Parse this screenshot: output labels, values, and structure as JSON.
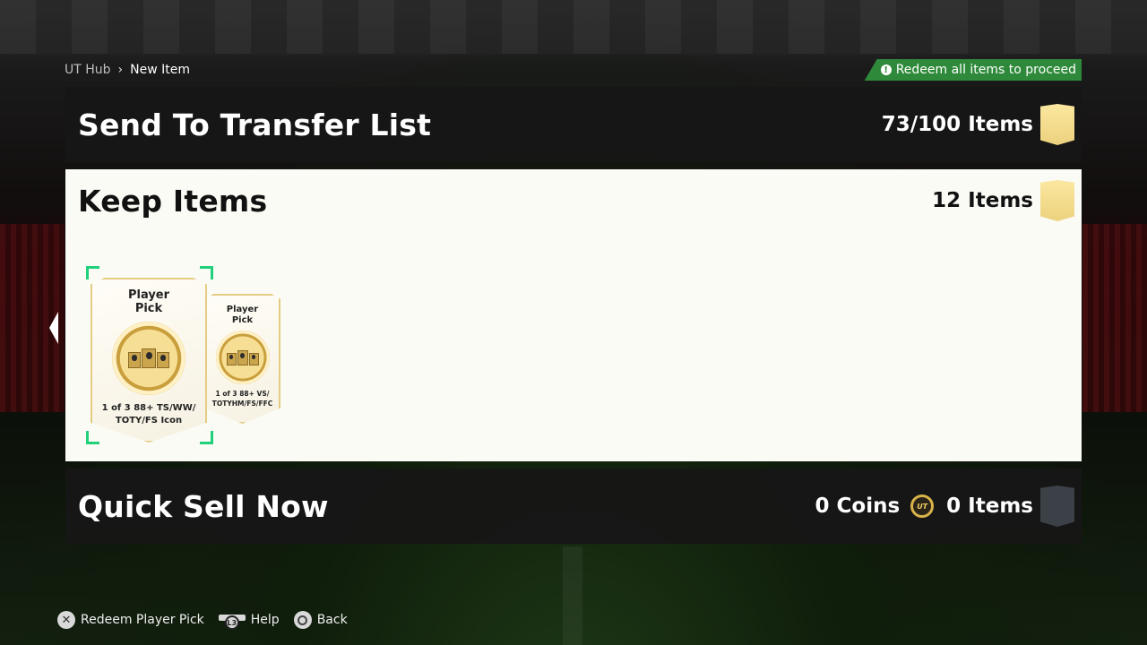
{
  "breadcrumb": {
    "root": "UT Hub",
    "current": "New Item"
  },
  "notice": {
    "text": "Redeem all items to proceed",
    "icon": "exclamation-icon",
    "color": "#2e8a3a"
  },
  "transfer_list": {
    "title": "Send To Transfer List",
    "count": "73/100 Items"
  },
  "keep_items": {
    "title": "Keep Items",
    "count": "12 Items",
    "cards": [
      {
        "title_line1": "Player",
        "title_line2": "Pick",
        "desc_line1": "1 of 3 88+ TS/WW/",
        "desc_line2": "TOTY/FS Icon"
      },
      {
        "title_line1": "Player",
        "title_line2": "Pick",
        "desc_line1": "1 of 3 88+ VS/",
        "desc_line2": "TOTYHM/FS/FFC"
      }
    ]
  },
  "quick_sell": {
    "title": "Quick Sell Now",
    "coins": "0 Coins",
    "coin_icon_label": "UT",
    "count": "0 Items"
  },
  "footer": {
    "redeem": {
      "icon": "cross-button-icon",
      "label": "Redeem Player Pick"
    },
    "help": {
      "icon": "l3-button-icon",
      "badge": "L3",
      "label": "Help"
    },
    "back": {
      "icon": "circle-button-icon",
      "label": "Back"
    }
  },
  "colors": {
    "selection": "#21d07a",
    "gold": "#ecd27e",
    "accent_green": "#2e8a3a"
  }
}
